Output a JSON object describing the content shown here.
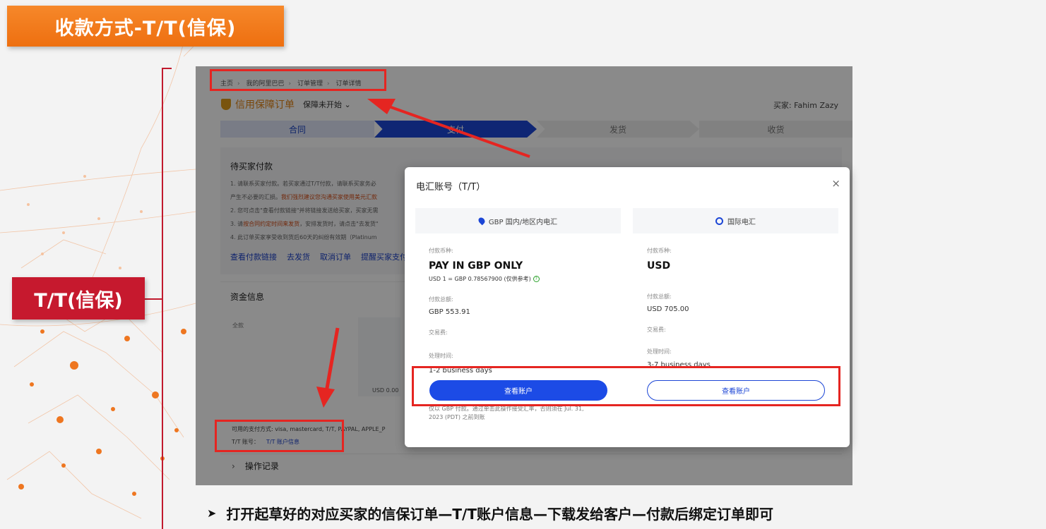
{
  "slide": {
    "title": "收款方式-T/T(信保)",
    "side_label": "T/T(信保)",
    "bullet_marker": "➤",
    "footer": "打开起草好的对应买家的信保订单—T/T账户信息—下载发给客户—付款后绑定订单即可",
    "accent_orange": "#f08019",
    "accent_red": "#c6192e"
  },
  "order_page": {
    "breadcrumb": [
      "主页",
      "我的阿里巴巴",
      "订单管理",
      "订单详情"
    ],
    "order_title": "信用保障订单",
    "order_status": "保障未开始",
    "buyer": "买家: Fahim Zazy",
    "steps": [
      "合同",
      "支付",
      "发货",
      "收货"
    ],
    "pending_title": "待买家付款",
    "pending_lines": [
      "1. 请联系买家付款。若买家通过T/T付款，请联系买家务必",
      "产生不必要的汇损。",
      "2. 您可点击\"查看付款链接\"并将链接发送给买家，买家无需",
      "3. 请",
      "4. 此订单买家享受收到货后60天的纠纷有效期（Platinum"
    ],
    "pending_highlight_1": "我们强烈建议您沟通买家使用美元汇款",
    "pending_highlight_2": "按合同约定时间来发货",
    "pending_suffix_2": "，安排发货时，请点击\"去发货\"",
    "actions": [
      "查看付款链接",
      "去发货",
      "取消订单",
      "提醒买家支付"
    ],
    "funds_title": "资金信息",
    "funds_total": "全款",
    "funds_usd": "USD 0.00",
    "payment_methods": "可用的支付方式: visa, mastercard, T/T, PAYPAL, APPLE_P",
    "tt_account_label": "T/T 账号：",
    "tt_account_link": "T/T 账户信息",
    "op_log": "操作记录"
  },
  "modal": {
    "title": "电汇账号（T/T）",
    "close": "×",
    "tabs": [
      {
        "label": "GBP 国内/地区内电汇",
        "icon": "location-pin-icon"
      },
      {
        "label": "国际电汇",
        "icon": "globe-icon"
      }
    ],
    "left": {
      "currency_label": "付款币种:",
      "currency": "PAY IN GBP ONLY",
      "rate": "USD 1 = GBP 0.78567900 (仅供参考)",
      "amount_label": "付款总额:",
      "amount": "GBP 553.91",
      "fee_label": "交易费:",
      "time_label": "处理时间:",
      "time": "1-2 business days",
      "button": "查看账户",
      "note": "仅以 GBP 付款。通过单击此操作接受汇率，否则须在 Jul. 31, 2023 (PDT) 之前到账"
    },
    "right": {
      "currency_label": "付款币种:",
      "currency": "USD",
      "amount_label": "付款总额:",
      "amount": "USD 705.00",
      "fee_label": "交易费:",
      "time_label": "处理时间:",
      "time": "3-7 business days",
      "button": "查看账户"
    }
  }
}
